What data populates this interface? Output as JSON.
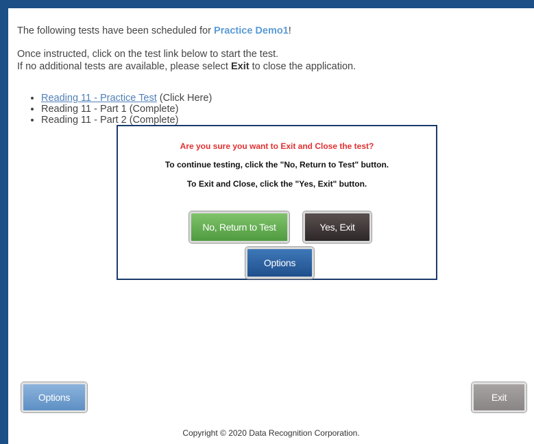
{
  "intro": {
    "scheduled_prefix": "The following tests have been scheduled for ",
    "student_name": "Practice Demo1",
    "scheduled_suffix": "!",
    "instruction_line1": "Once instructed, click on the test link below to start the test.",
    "instruction_line2_prefix": "If no additional tests are available, please select ",
    "instruction_line2_bold": "Exit",
    "instruction_line2_suffix": " to close the application."
  },
  "tests": [
    {
      "name": "Reading 11 - Practice Test",
      "status": " (Click Here)"
    },
    {
      "name": "Reading 11 - Part 1",
      "status": " (Complete)"
    },
    {
      "name": "Reading 11 - Part 2",
      "status": " (Complete)"
    }
  ],
  "dialog": {
    "warning": "Are you sure you want to Exit and Close the test?",
    "continue_msg": "To continue testing, click the \"No, Return to Test\" button.",
    "exit_msg": "To Exit and Close, click the \"Yes, Exit\" button.",
    "no_label": "No, Return to Test",
    "yes_label": "Yes, Exit",
    "options_label": "Options"
  },
  "footer": {
    "options_label": "Options",
    "exit_label": "Exit",
    "copyright": "Copyright © 2020 Data Recognition Corporation."
  },
  "colors": {
    "frame_border": "#1b4f86",
    "student_name": "#5b9bd5",
    "warning_text": "#e03030",
    "no_button": "#5aa548",
    "yes_button": "#3a3232",
    "options_button": "#2a5e9e"
  }
}
